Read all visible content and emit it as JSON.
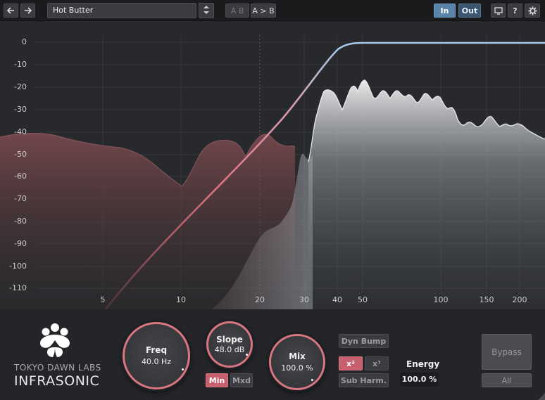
{
  "toolbar": {
    "back_icon": "arrow-left-icon",
    "forward_icon": "arrow-right-icon",
    "preset_name": "Hot Butter",
    "ab_label": "A B",
    "a_to_b_label": "A > B",
    "in_label": "In",
    "out_label": "Out",
    "help_label": "?",
    "display_icon": "monitor-icon",
    "settings_icon": "gear-icon"
  },
  "graph": {
    "y_ticks": [
      "0",
      "-10",
      "-20",
      "-30",
      "-40",
      "-50",
      "-60",
      "-70",
      "-80",
      "-90",
      "-100",
      "-110"
    ],
    "x_ticks": [
      "5",
      "10",
      "20",
      "30",
      "40",
      "50",
      "100",
      "150",
      "200"
    ],
    "filter_color_low": "#e07080",
    "filter_color_high": "#a8c8e8"
  },
  "brand": {
    "company": "TOKYO DAWN LABS",
    "product": "INFRASONIC",
    "logo_icon": "flower-logo-icon"
  },
  "controls": {
    "freq": {
      "label": "Freq",
      "value": "40.0 Hz"
    },
    "slope": {
      "label": "Slope",
      "value": "48.0 dB"
    },
    "mix": {
      "label": "Mix",
      "value": "100.0 %"
    },
    "min_label": "Min",
    "mxd_label": "Mxd",
    "dyn_bump_label": "Dyn Bump",
    "x2_label": "x²",
    "x3_label": "x³",
    "sub_harm_label": "Sub Harm.",
    "energy_label": "Energy",
    "energy_value": "100.0 %",
    "bypass_label": "Bypass",
    "all_label": "All"
  },
  "colors": {
    "accent": "#d97781",
    "blue_active": "#5a83a8"
  }
}
